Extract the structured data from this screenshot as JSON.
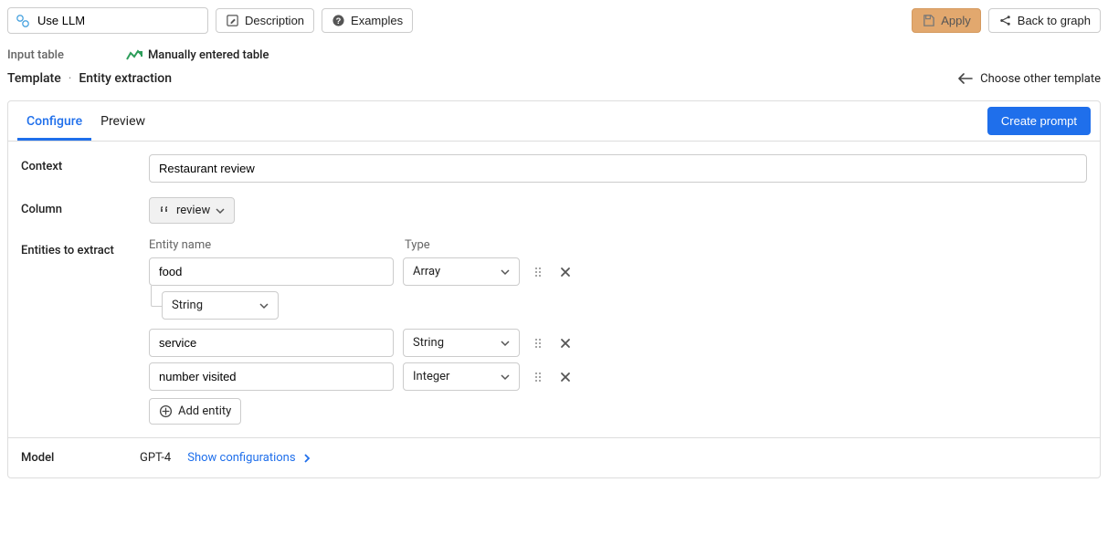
{
  "header": {
    "title": "Use LLM",
    "description_btn": "Description",
    "examples_btn": "Examples",
    "apply_btn": "Apply",
    "back_btn": "Back to graph"
  },
  "input_table": {
    "label": "Input table",
    "source": "Manually entered table"
  },
  "breadcrumb": {
    "template": "Template",
    "name": "Entity extraction",
    "choose_other": "Choose other template"
  },
  "tabs": {
    "configure": "Configure",
    "preview": "Preview",
    "create_prompt": "Create prompt"
  },
  "form": {
    "context_label": "Context",
    "context_value": "Restaurant review",
    "column_label": "Column",
    "column_value": "review",
    "entities_label": "Entities to extract",
    "entity_name_header": "Entity name",
    "type_header": "Type",
    "entities": [
      {
        "name": "food",
        "type": "Array",
        "sub_type": "String"
      },
      {
        "name": "service",
        "type": "String"
      },
      {
        "name": "number visited",
        "type": "Integer"
      }
    ],
    "add_entity": "Add entity"
  },
  "model": {
    "label": "Model",
    "name": "GPT-4",
    "config_link": "Show configurations"
  }
}
